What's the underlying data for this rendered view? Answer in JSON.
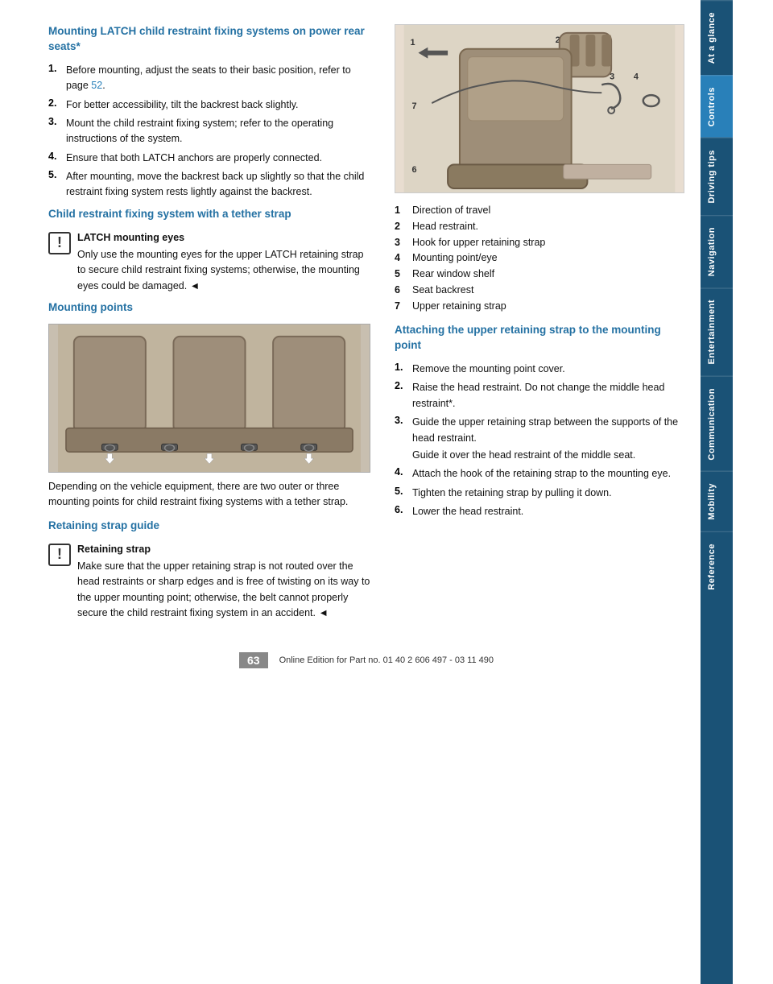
{
  "page": {
    "number": "63",
    "footer_text": "Online Edition for Part no. 01 40 2 606 497 - 03 11 490"
  },
  "sidebar": {
    "tabs": [
      {
        "label": "At a glance",
        "active": false
      },
      {
        "label": "Controls",
        "active": true
      },
      {
        "label": "Driving tips",
        "active": false
      },
      {
        "label": "Navigation",
        "active": false
      },
      {
        "label": "Entertainment",
        "active": false
      },
      {
        "label": "Communication",
        "active": false
      },
      {
        "label": "Mobility",
        "active": false
      },
      {
        "label": "Reference",
        "active": false
      }
    ]
  },
  "left_column": {
    "main_title": "Mounting LATCH child restraint fixing systems on power rear seats*",
    "steps": [
      {
        "num": "1.",
        "text": "Before mounting, adjust the seats to their basic position, refer to page 52."
      },
      {
        "num": "2.",
        "text": "For better accessibility, tilt the backrest back slightly."
      },
      {
        "num": "3.",
        "text": "Mount the child restraint fixing system; refer to the operating instructions of the system."
      },
      {
        "num": "4.",
        "text": "Ensure that both LATCH anchors are properly connected."
      },
      {
        "num": "5.",
        "text": "After mounting, move the backrest back up slightly so that the child restraint fixing system rests lightly against the backrest."
      }
    ],
    "tether_title": "Child restraint fixing system with a tether strap",
    "warning_title": "LATCH mounting eyes",
    "warning_text": "Only use the mounting eyes for the upper LATCH retaining strap to secure child restraint fixing systems; otherwise, the mounting eyes could be damaged.",
    "mounting_title": "Mounting points",
    "mounting_caption": "Depending on the vehicle equipment, there are two outer or three mounting points for child restraint fixing systems with a tether strap.",
    "retaining_title": "Retaining strap guide",
    "retaining_warning_title": "Retaining strap",
    "retaining_warning_text": "Make sure that the upper retaining strap is not routed over the head restraints or sharp edges and is free of twisting on its way to the upper mounting point; otherwise, the belt cannot properly secure the child restraint fixing system in an accident."
  },
  "right_column": {
    "diagram_labels": [
      {
        "num": "1",
        "text": "Direction of travel"
      },
      {
        "num": "2",
        "text": "Head restraint."
      },
      {
        "num": "3",
        "text": "Hook for upper retaining strap"
      },
      {
        "num": "4",
        "text": "Mounting point/eye"
      },
      {
        "num": "5",
        "text": "Rear window shelf"
      },
      {
        "num": "6",
        "text": "Seat backrest"
      },
      {
        "num": "7",
        "text": "Upper retaining strap"
      }
    ],
    "attaching_title": "Attaching the upper retaining strap to the mounting point",
    "attaching_steps": [
      {
        "num": "1.",
        "text": "Remove the mounting point cover."
      },
      {
        "num": "2.",
        "text": "Raise the head restraint. Do not change the middle head restraint*."
      },
      {
        "num": "3.",
        "text": "Guide the upper retaining strap between the supports of the head restraint.\nGuide it over the head restraint of the middle seat."
      },
      {
        "num": "4.",
        "text": "Attach the hook of the retaining strap to the mounting eye."
      },
      {
        "num": "5.",
        "text": "Tighten the retaining strap by pulling it down."
      },
      {
        "num": "6.",
        "text": "Lower the head restraint."
      }
    ]
  }
}
